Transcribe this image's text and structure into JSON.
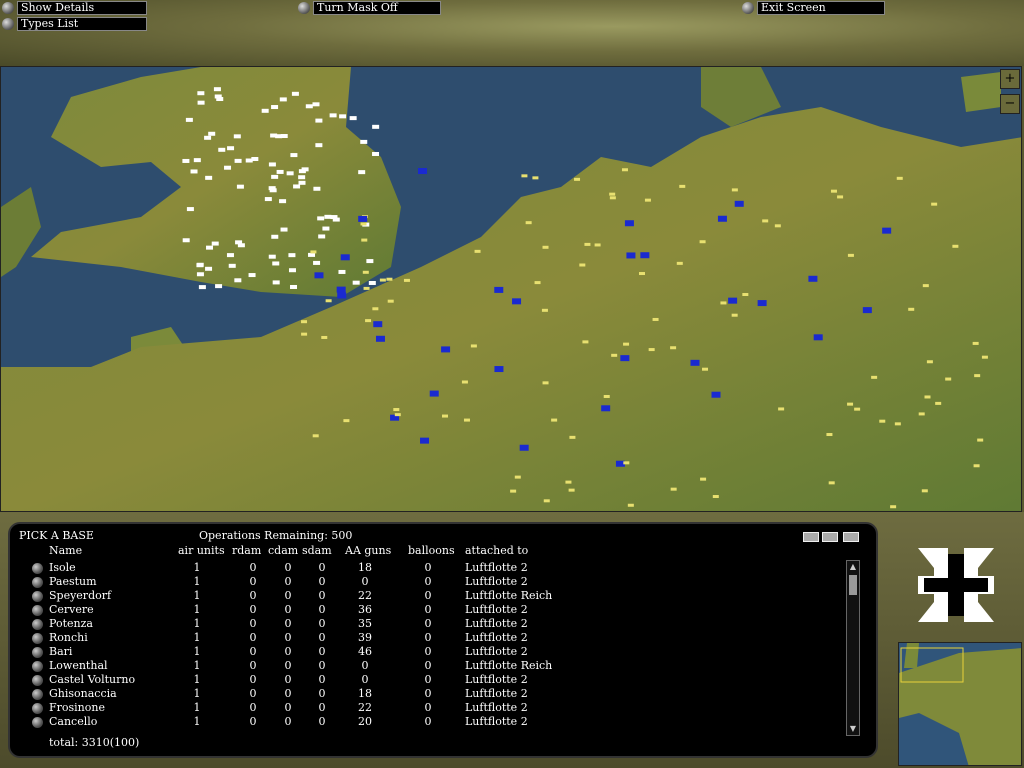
{
  "toolbar": {
    "show_details": "Show Details",
    "types_list": "Types List",
    "turn_mask_off": "Turn Mask Off",
    "exit_screen": "Exit Screen"
  },
  "map": {
    "zoom_in": "+",
    "zoom_out": "−"
  },
  "panel": {
    "title": "PICK A BASE",
    "operations": "Operations Remaining: 500",
    "columns": [
      "Name",
      "air units",
      "rdam",
      "cdam",
      "sdam",
      "AA guns",
      "balloons",
      "attached to"
    ],
    "rows": [
      [
        "Isole",
        "1",
        "0",
        "0",
        "0",
        "18",
        "0",
        "Luftflotte 2"
      ],
      [
        "Paestum",
        "1",
        "0",
        "0",
        "0",
        "0",
        "0",
        "Luftflotte 2"
      ],
      [
        "Speyerdorf",
        "1",
        "0",
        "0",
        "0",
        "22",
        "0",
        "Luftflotte Reich"
      ],
      [
        "Cervere",
        "1",
        "0",
        "0",
        "0",
        "36",
        "0",
        "Luftflotte 2"
      ],
      [
        "Potenza",
        "1",
        "0",
        "0",
        "0",
        "35",
        "0",
        "Luftflotte 2"
      ],
      [
        "Ronchi",
        "1",
        "0",
        "0",
        "0",
        "39",
        "0",
        "Luftflotte 2"
      ],
      [
        "Bari",
        "1",
        "0",
        "0",
        "0",
        "46",
        "0",
        "Luftflotte 2"
      ],
      [
        "Lowenthal",
        "1",
        "0",
        "0",
        "0",
        "0",
        "0",
        "Luftflotte Reich"
      ],
      [
        "Castel Volturno",
        "1",
        "0",
        "0",
        "0",
        "0",
        "0",
        "Luftflotte 2"
      ],
      [
        "Ghisonaccia",
        "1",
        "0",
        "0",
        "0",
        "18",
        "0",
        "Luftflotte 2"
      ],
      [
        "Frosinone",
        "1",
        "0",
        "0",
        "0",
        "22",
        "0",
        "Luftflotte 2"
      ],
      [
        "Cancello",
        "1",
        "0",
        "0",
        "0",
        "20",
        "0",
        "Luftflotte 2"
      ]
    ],
    "total": "total: 3310(100)"
  },
  "colors": {
    "sea": "#2e4d6e",
    "land": "#7f8a3a",
    "allied_marker": "#ffffff",
    "axis_marker": "#1a2ad0"
  }
}
